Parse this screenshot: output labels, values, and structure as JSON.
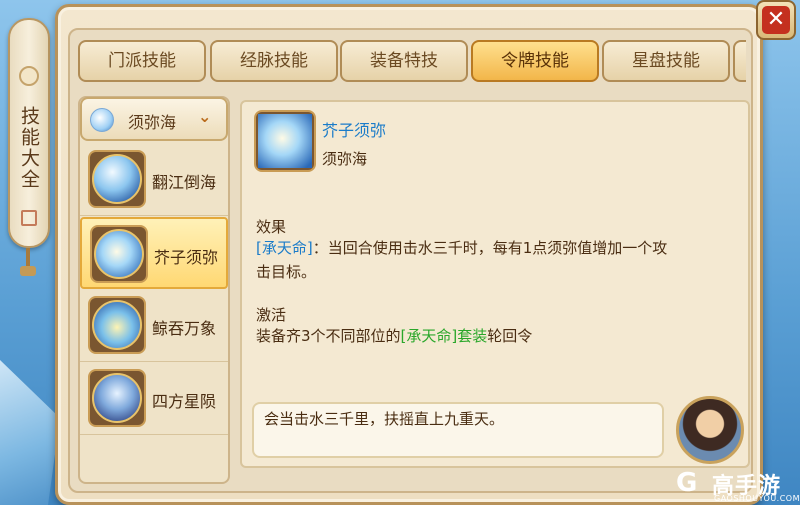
{
  "side_scroll": {
    "title": "技能大全"
  },
  "tabs": [
    {
      "label": "门派技能",
      "active": false
    },
    {
      "label": "经脉技能",
      "active": false
    },
    {
      "label": "装备特技",
      "active": false
    },
    {
      "label": "令牌技能",
      "active": true
    },
    {
      "label": "星盘技能",
      "active": false
    }
  ],
  "sect_dropdown": {
    "selected": "须弥海"
  },
  "skills": [
    {
      "name": "翻江倒海",
      "icon": "wave-orb-icon",
      "active": false
    },
    {
      "name": "芥子须弥",
      "icon": "swirl-orb-icon",
      "active": true
    },
    {
      "name": "鲸吞万象",
      "icon": "whale-orb-icon",
      "active": false
    },
    {
      "name": "四方星陨",
      "icon": "star-orb-icon",
      "active": false
    }
  ],
  "detail": {
    "name": "芥子须弥",
    "sect": "须弥海",
    "effect_heading": "效果",
    "effect_tag": "[承天命]",
    "effect_text_a": "：当回合使用击水三千时，每有1点须弥值增加一个攻",
    "effect_text_b": "击目标。",
    "activate_heading": "激活",
    "activate_pre": "装备齐3个不同部位的",
    "activate_set": "[承天命]套装",
    "activate_post": "轮回令",
    "quote": "会当击水三千里，扶摇直上九重天。"
  },
  "watermark": {
    "logo": "G",
    "brand": "高手游",
    "url": "GAOSHOUYOU.COM"
  },
  "colors": {
    "accent_blue": "#1b7cc9",
    "accent_green": "#2aa72a",
    "active_tab": "#f2b64a",
    "close_red": "#c4301f"
  }
}
